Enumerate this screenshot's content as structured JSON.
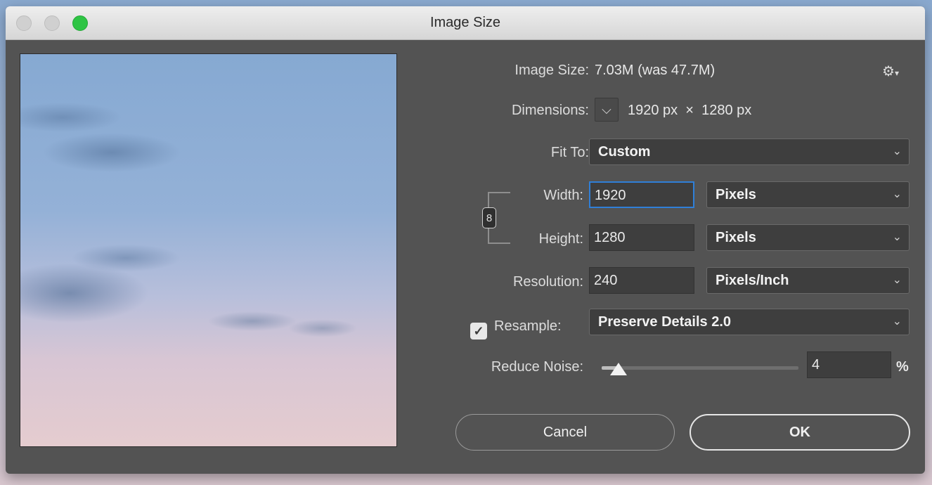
{
  "window": {
    "title": "Image Size"
  },
  "info": {
    "image_size_label": "Image Size:",
    "image_size_value": "7.03M (was 47.7M)",
    "dimensions_label": "Dimensions:",
    "dimensions_value": "1920 px  ×  1280 px"
  },
  "fit_to": {
    "label": "Fit To:",
    "value": "Custom"
  },
  "width": {
    "label": "Width:",
    "value": "1920",
    "unit": "Pixels"
  },
  "height": {
    "label": "Height:",
    "value": "1280",
    "unit": "Pixels"
  },
  "resolution": {
    "label": "Resolution:",
    "value": "240",
    "unit": "Pixels/Inch"
  },
  "resample": {
    "label": "Resample:",
    "checked": true,
    "method": "Preserve Details 2.0"
  },
  "reduce_noise": {
    "label": "Reduce Noise:",
    "value": "4",
    "unit": "%",
    "level": 0.04
  },
  "buttons": {
    "cancel": "Cancel",
    "ok": "OK"
  },
  "icons": {
    "gear": "gear-icon",
    "dropdown": "chevron-down-icon",
    "link": "chain-link-icon",
    "check": "check-icon"
  },
  "colors": {
    "focus": "#2f7fd8",
    "maximize": "#2ec444"
  }
}
